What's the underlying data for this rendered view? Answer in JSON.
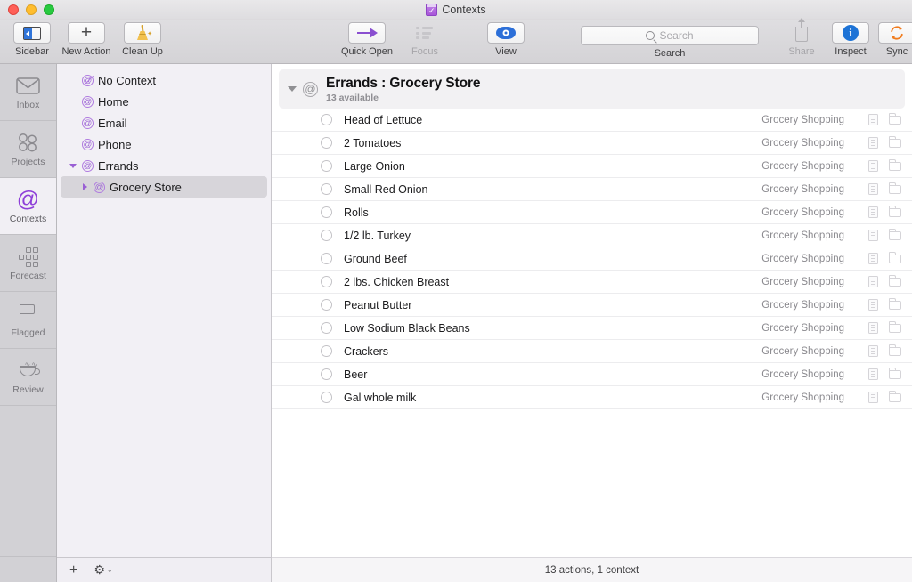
{
  "window": {
    "title": "Contexts",
    "app_icon": "omnifocus-checkbox-icon"
  },
  "toolbar": {
    "left": [
      {
        "label": "Sidebar",
        "icon": "sidebar-toggle-icon",
        "enabled": true
      },
      {
        "label": "New Action",
        "icon": "plus-icon",
        "enabled": true
      },
      {
        "label": "Clean Up",
        "icon": "broom-icon",
        "enabled": true
      }
    ],
    "center": [
      {
        "label": "Quick Open",
        "icon": "arrow-right-icon",
        "enabled": true
      },
      {
        "label": "Focus",
        "icon": "bullet-list-icon",
        "enabled": false
      },
      {
        "label": "View",
        "icon": "eye-icon",
        "enabled": true
      }
    ],
    "search": {
      "label": "Search",
      "placeholder": "Search",
      "value": "",
      "icon": "magnifier-icon"
    },
    "right": [
      {
        "label": "Share",
        "icon": "share-icon",
        "enabled": false
      },
      {
        "label": "Inspect",
        "icon": "info-icon",
        "enabled": true
      },
      {
        "label": "Sync",
        "icon": "sync-icon",
        "enabled": true
      }
    ]
  },
  "perspectives": [
    {
      "label": "Inbox",
      "icon": "inbox-icon",
      "active": false
    },
    {
      "label": "Projects",
      "icon": "projects-icon",
      "active": false
    },
    {
      "label": "Contexts",
      "icon": "at-sign-icon",
      "active": true
    },
    {
      "label": "Forecast",
      "icon": "forecast-grid-icon",
      "active": false
    },
    {
      "label": "Flagged",
      "icon": "flag-icon",
      "active": false
    },
    {
      "label": "Review",
      "icon": "coffee-cup-icon",
      "active": false
    }
  ],
  "context_tree": [
    {
      "label": "No Context",
      "icon": "at-sign-slashed-icon",
      "indent": false,
      "twisty": "none",
      "selected": false
    },
    {
      "label": "Home",
      "icon": "at-sign-icon",
      "indent": false,
      "twisty": "none",
      "selected": false
    },
    {
      "label": "Email",
      "icon": "at-sign-icon",
      "indent": false,
      "twisty": "none",
      "selected": false
    },
    {
      "label": "Phone",
      "icon": "at-sign-icon",
      "indent": false,
      "twisty": "none",
      "selected": false
    },
    {
      "label": "Errands",
      "icon": "at-sign-icon",
      "indent": false,
      "twisty": "down",
      "selected": false
    },
    {
      "label": "Grocery Store",
      "icon": "at-sign-icon",
      "indent": true,
      "twisty": "right",
      "selected": true
    }
  ],
  "tree_footer": {
    "add_label": "+",
    "gear_label": "⚙",
    "caret_label": "⌄"
  },
  "group_header": {
    "title": "Errands : Grocery Store",
    "subtitle": "13 available",
    "icon": "at-sign-icon",
    "twisty": "down"
  },
  "tasks": [
    {
      "name": "Head of Lettuce",
      "project": "Grocery Shopping",
      "completed": false
    },
    {
      "name": "2 Tomatoes",
      "project": "Grocery Shopping",
      "completed": false
    },
    {
      "name": "Large Onion",
      "project": "Grocery Shopping",
      "completed": false
    },
    {
      "name": "Small Red Onion",
      "project": "Grocery Shopping",
      "completed": false
    },
    {
      "name": "Rolls",
      "project": "Grocery Shopping",
      "completed": false
    },
    {
      "name": "1/2 lb. Turkey",
      "project": "Grocery Shopping",
      "completed": false
    },
    {
      "name": "Ground Beef",
      "project": "Grocery Shopping",
      "completed": false
    },
    {
      "name": "2 lbs. Chicken Breast",
      "project": "Grocery Shopping",
      "completed": false
    },
    {
      "name": "Peanut Butter",
      "project": "Grocery Shopping",
      "completed": false
    },
    {
      "name": "Low Sodium Black Beans",
      "project": "Grocery Shopping",
      "completed": false
    },
    {
      "name": "Crackers",
      "project": "Grocery Shopping",
      "completed": false
    },
    {
      "name": "Beer",
      "project": "Grocery Shopping",
      "completed": false
    },
    {
      "name": "Gal whole milk",
      "project": "Grocery Shopping",
      "completed": false
    }
  ],
  "row_icons": {
    "note": "note-icon",
    "folder": "folder-icon"
  },
  "status_bar": {
    "text": "13 actions, 1 context"
  },
  "colors": {
    "accent_purple": "#8e3fd8",
    "accent_blue": "#2c6fd8",
    "sync_orange": "#f07b1d",
    "selection_gray": "#d7d5da",
    "rail_bg": "#d2d1d5",
    "tree_bg": "#f2f0f5"
  }
}
